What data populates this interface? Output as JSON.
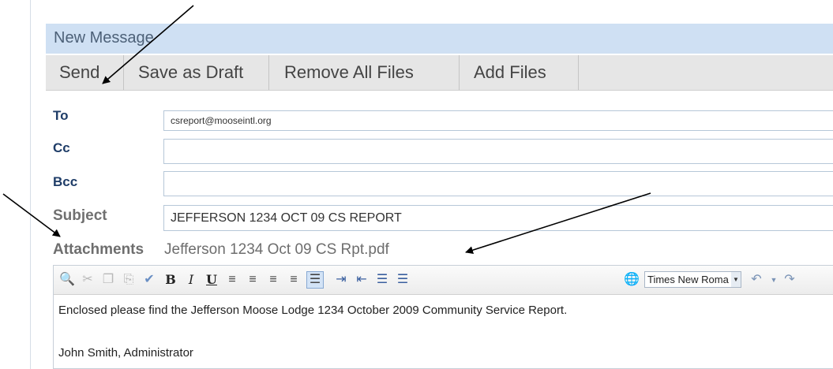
{
  "window": {
    "title": "New Message"
  },
  "toolbar": {
    "send": "Send",
    "save_draft": "Save as Draft",
    "remove_files": "Remove All Files",
    "add_files": "Add Files"
  },
  "fields": {
    "to": {
      "label": "To",
      "value": "csreport@mooseintl.org"
    },
    "cc": {
      "label": "Cc",
      "value": ""
    },
    "bcc": {
      "label": "Bcc",
      "value": ""
    },
    "subject": {
      "label": "Subject",
      "value": "JEFFERSON 1234 OCT 09 CS REPORT"
    }
  },
  "attachments": {
    "label": "Attachments",
    "file": "Jefferson 1234 Oct 09 CS Rpt.pdf"
  },
  "editor": {
    "font_name": "Times New Roma",
    "body_lines": [
      "Enclosed please find the Jefferson Moose Lodge 1234 October 2009 Community Service Report.",
      "John Smith, Administrator"
    ]
  }
}
